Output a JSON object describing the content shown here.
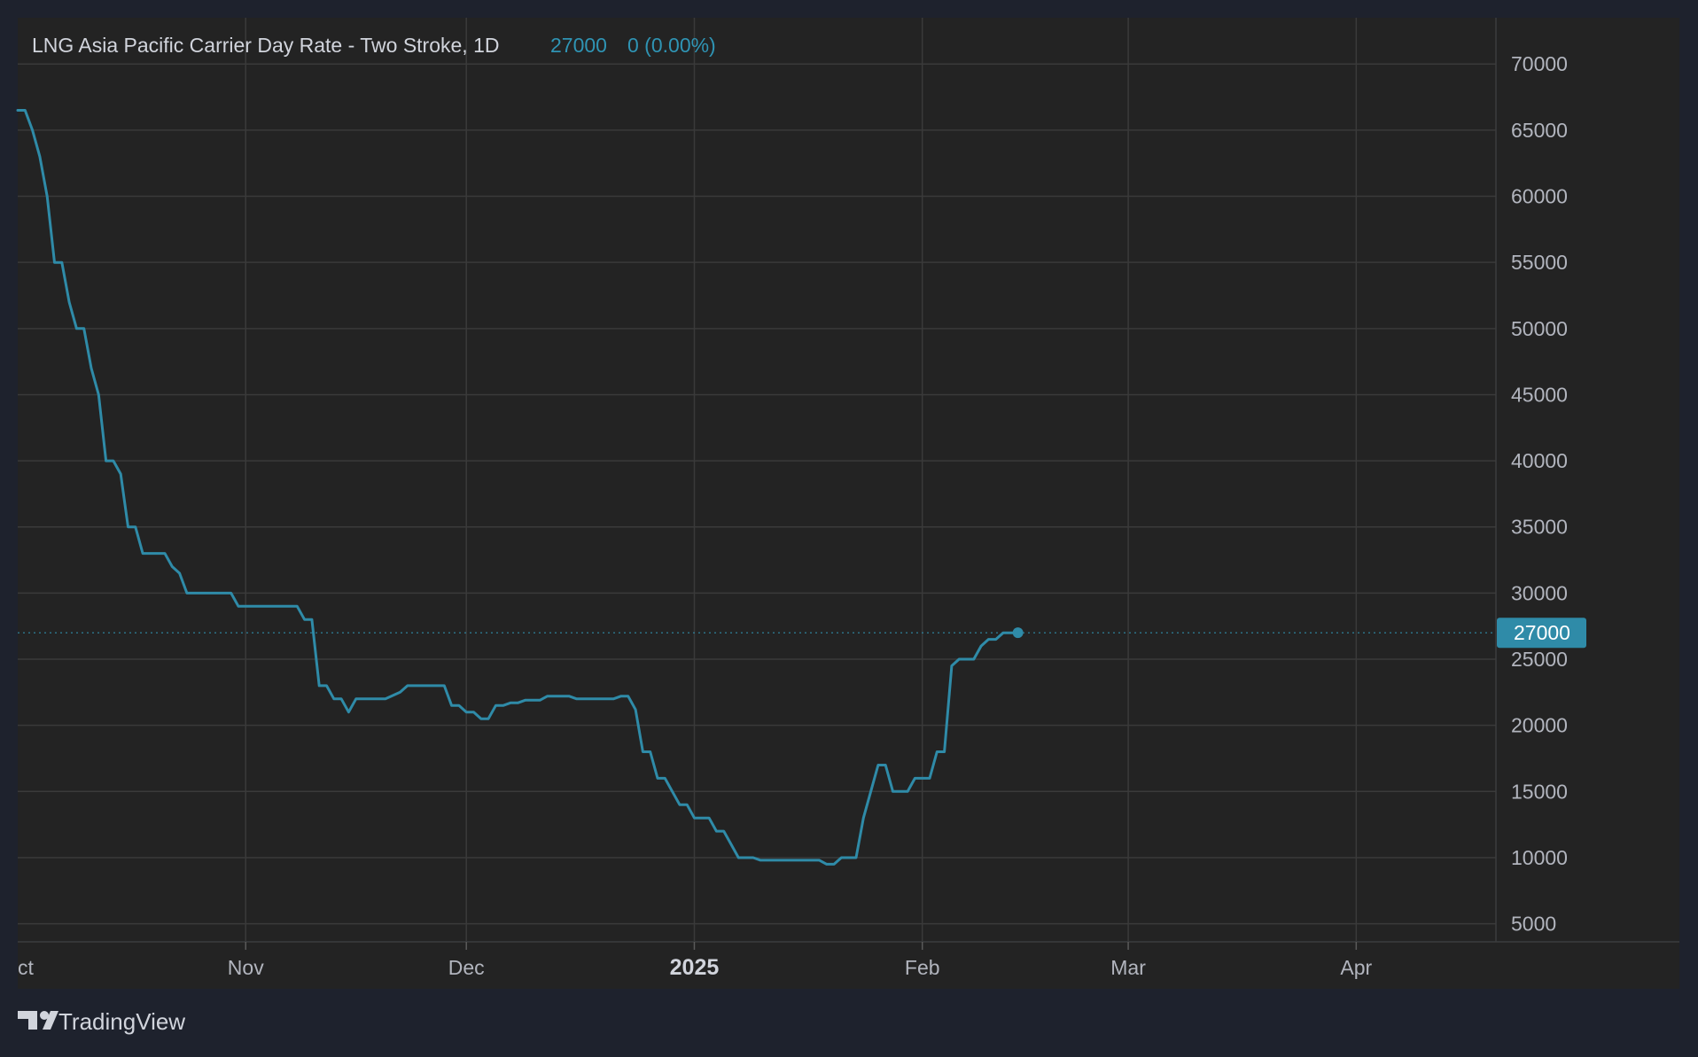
{
  "legend": {
    "title": "LNG Asia Pacific Carrier Day Rate - Two Stroke, 1D",
    "last_value": "27000",
    "change": "0 (0.00%)"
  },
  "price_tag": "27000",
  "brand": {
    "name": "TradingView",
    "logo": "tradingview-logo-icon"
  },
  "colors": {
    "background": "#1e222d",
    "pane": "#232323",
    "grid": "#3a3a3a",
    "line": "#2f8ba8",
    "text": "#b2b5be"
  },
  "chart_data": {
    "type": "line",
    "title": "LNG Asia Pacific Carrier Day Rate - Two Stroke, 1D",
    "xlabel": "",
    "ylabel": "",
    "x_axis": "date",
    "xlim": [
      "2024-10-01",
      "2025-04-20"
    ],
    "ylim": [
      3700,
      73500
    ],
    "y_ticks": [
      70000,
      65000,
      60000,
      55000,
      50000,
      45000,
      40000,
      35000,
      30000,
      25000,
      20000,
      15000,
      10000,
      5000
    ],
    "x_ticks": [
      {
        "label": "ct",
        "date": "2024-10-01",
        "bold": false
      },
      {
        "label": "Nov",
        "date": "2024-11-01",
        "bold": false
      },
      {
        "label": "Dec",
        "date": "2024-12-01",
        "bold": false
      },
      {
        "label": "2025",
        "date": "2025-01-01",
        "bold": true
      },
      {
        "label": "Feb",
        "date": "2025-02-01",
        "bold": false
      },
      {
        "label": "Mar",
        "date": "2025-03-01",
        "bold": false
      },
      {
        "label": "Apr",
        "date": "2025-04-01",
        "bold": false
      }
    ],
    "grid": true,
    "legend": "top-left",
    "last_price": 27000,
    "series": [
      {
        "points": [
          [
            "2024-10-01",
            66500
          ],
          [
            "2024-10-02",
            66500
          ],
          [
            "2024-10-03",
            65000
          ],
          [
            "2024-10-04",
            63000
          ],
          [
            "2024-10-05",
            60000
          ],
          [
            "2024-10-06",
            55000
          ],
          [
            "2024-10-07",
            55000
          ],
          [
            "2024-10-08",
            52000
          ],
          [
            "2024-10-09",
            50000
          ],
          [
            "2024-10-10",
            50000
          ],
          [
            "2024-10-11",
            47000
          ],
          [
            "2024-10-12",
            45000
          ],
          [
            "2024-10-13",
            40000
          ],
          [
            "2024-10-14",
            40000
          ],
          [
            "2024-10-15",
            39000
          ],
          [
            "2024-10-16",
            35000
          ],
          [
            "2024-10-17",
            35000
          ],
          [
            "2024-10-18",
            33000
          ],
          [
            "2024-10-21",
            33000
          ],
          [
            "2024-10-22",
            32000
          ],
          [
            "2024-10-23",
            31500
          ],
          [
            "2024-10-24",
            30000
          ],
          [
            "2024-10-30",
            30000
          ],
          [
            "2024-10-31",
            29000
          ],
          [
            "2024-11-08",
            29000
          ],
          [
            "2024-11-09",
            28000
          ],
          [
            "2024-11-10",
            28000
          ],
          [
            "2024-11-11",
            23000
          ],
          [
            "2024-11-12",
            23000
          ],
          [
            "2024-11-13",
            22000
          ],
          [
            "2024-11-14",
            22000
          ],
          [
            "2024-11-15",
            21000
          ],
          [
            "2024-11-16",
            22000
          ],
          [
            "2024-11-20",
            22000
          ],
          [
            "2024-11-22",
            22500
          ],
          [
            "2024-11-23",
            23000
          ],
          [
            "2024-11-28",
            23000
          ],
          [
            "2024-11-29",
            21500
          ],
          [
            "2024-11-30",
            21500
          ],
          [
            "2024-12-01",
            21000
          ],
          [
            "2024-12-02",
            21000
          ],
          [
            "2024-12-03",
            20500
          ],
          [
            "2024-12-04",
            20500
          ],
          [
            "2024-12-05",
            21500
          ],
          [
            "2024-12-06",
            21500
          ],
          [
            "2024-12-07",
            21700
          ],
          [
            "2024-12-08",
            21700
          ],
          [
            "2024-12-09",
            21900
          ],
          [
            "2024-12-11",
            21900
          ],
          [
            "2024-12-12",
            22200
          ],
          [
            "2024-12-15",
            22200
          ],
          [
            "2024-12-16",
            22000
          ],
          [
            "2024-12-21",
            22000
          ],
          [
            "2024-12-22",
            22200
          ],
          [
            "2024-12-23",
            22200
          ],
          [
            "2024-12-24",
            21200
          ],
          [
            "2024-12-25",
            18000
          ],
          [
            "2024-12-26",
            18000
          ],
          [
            "2024-12-27",
            16000
          ],
          [
            "2024-12-28",
            16000
          ],
          [
            "2024-12-29",
            15000
          ],
          [
            "2024-12-30",
            14000
          ],
          [
            "2024-12-31",
            14000
          ],
          [
            "2025-01-01",
            13000
          ],
          [
            "2025-01-03",
            13000
          ],
          [
            "2025-01-04",
            12000
          ],
          [
            "2025-01-05",
            12000
          ],
          [
            "2025-01-06",
            11000
          ],
          [
            "2025-01-07",
            10000
          ],
          [
            "2025-01-09",
            10000
          ],
          [
            "2025-01-10",
            9800
          ],
          [
            "2025-01-18",
            9800
          ],
          [
            "2025-01-19",
            9500
          ],
          [
            "2025-01-20",
            9500
          ],
          [
            "2025-01-21",
            10000
          ],
          [
            "2025-01-23",
            10000
          ],
          [
            "2025-01-24",
            13000
          ],
          [
            "2025-01-25",
            15000
          ],
          [
            "2025-01-26",
            17000
          ],
          [
            "2025-01-27",
            17000
          ],
          [
            "2025-01-28",
            15000
          ],
          [
            "2025-01-30",
            15000
          ],
          [
            "2025-01-31",
            16000
          ],
          [
            "2025-02-02",
            16000
          ],
          [
            "2025-02-03",
            18000
          ],
          [
            "2025-02-04",
            18000
          ],
          [
            "2025-02-05",
            24500
          ],
          [
            "2025-02-06",
            25000
          ],
          [
            "2025-02-08",
            25000
          ],
          [
            "2025-02-09",
            26000
          ],
          [
            "2025-02-10",
            26500
          ],
          [
            "2025-02-11",
            26500
          ],
          [
            "2025-02-12",
            27000
          ],
          [
            "2025-02-14",
            27000
          ]
        ]
      }
    ]
  }
}
